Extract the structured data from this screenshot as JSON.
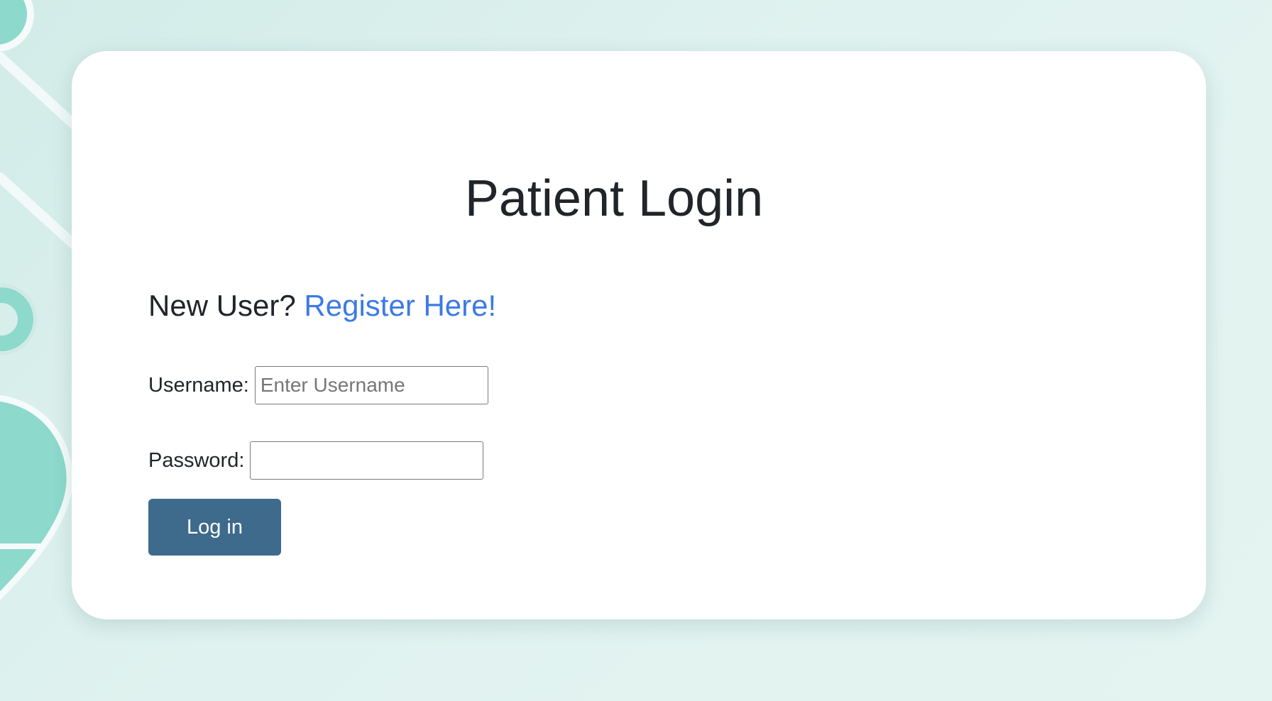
{
  "page": {
    "title": "Patient Login"
  },
  "register": {
    "prompt": "New User?",
    "link_label": "Register Here!"
  },
  "form": {
    "username_label": "Username:",
    "username_placeholder": "Enter Username",
    "username_value": "",
    "password_label": "Password:",
    "password_placeholder": "",
    "password_value": "",
    "submit_label": "Log in"
  },
  "colors": {
    "background": "#d8efeb",
    "decoration": "#8dd9cc",
    "card": "#ffffff",
    "title_text": "#212529",
    "link": "#3b7ae6",
    "button": "#3e6a8c",
    "button_text": "#ffffff"
  },
  "icons": {
    "background_decoration": "medical-pill-shapes"
  }
}
